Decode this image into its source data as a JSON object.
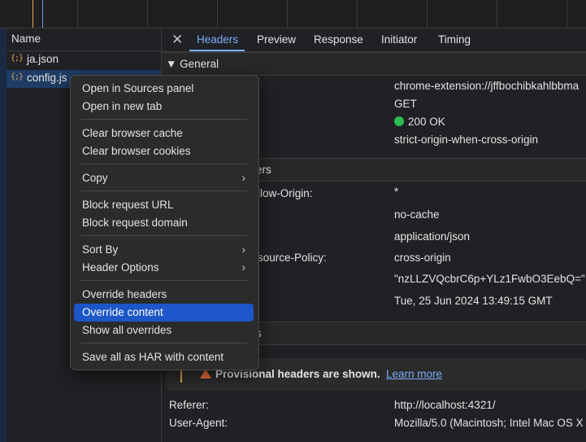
{
  "requests": {
    "header": "Name",
    "items": [
      {
        "icon": "{;}",
        "name": "ja.json",
        "selected": false
      },
      {
        "icon": "{;}",
        "name": "config.js",
        "selected": true
      }
    ]
  },
  "detail_tabs": {
    "close_symbol": "✕",
    "tabs": [
      "Headers",
      "Preview",
      "Response",
      "Initiator",
      "Timing"
    ],
    "active": "Headers"
  },
  "general": {
    "title": "▼ General",
    "values": [
      "chrome-extension://jffbochibkahlbbma",
      "GET",
      "200 OK",
      "strict-origin-when-cross-origin"
    ]
  },
  "response_headers": {
    "title_fragment": "ers",
    "keys": [
      "llow-Origin:",
      "",
      "",
      "source-Policy:"
    ],
    "values": [
      "*",
      "no-cache",
      "application/json",
      "cross-origin",
      "\"nzLLZVQcbrC6p+YLz1FwbO3EebQ=\"",
      "Tue, 25 Jun 2024 13:49:15 GMT"
    ]
  },
  "request_headers": {
    "title_fragment": "s",
    "provisional_text": "Provisional headers are shown.",
    "learn_more": "Learn more",
    "rows": [
      {
        "key": "Referer:",
        "value": "http://localhost:4321/"
      },
      {
        "key": "User-Agent:",
        "value": "Mozilla/5.0 (Macintosh; Intel Mac OS X"
      }
    ]
  },
  "context_menu": {
    "items": [
      {
        "label": "Open in Sources panel"
      },
      {
        "label": "Open in new tab"
      },
      {
        "label": "Clear browser cache"
      },
      {
        "label": "Clear browser cookies"
      },
      {
        "label": "Copy",
        "submenu": true
      },
      {
        "label": "Block request URL"
      },
      {
        "label": "Block request domain"
      },
      {
        "label": "Sort By",
        "submenu": true
      },
      {
        "label": "Header Options",
        "submenu": true
      },
      {
        "label": "Override headers"
      },
      {
        "label": "Override content",
        "highlighted": true
      },
      {
        "label": "Show all overrides"
      },
      {
        "label": "Save all as HAR with content"
      }
    ],
    "chevron": "›"
  },
  "colors": {
    "accent": "#7cacf8",
    "menu_highlight": "#1c56c8",
    "status_ok": "#2dbb56",
    "warning": "#ee6b3a"
  }
}
